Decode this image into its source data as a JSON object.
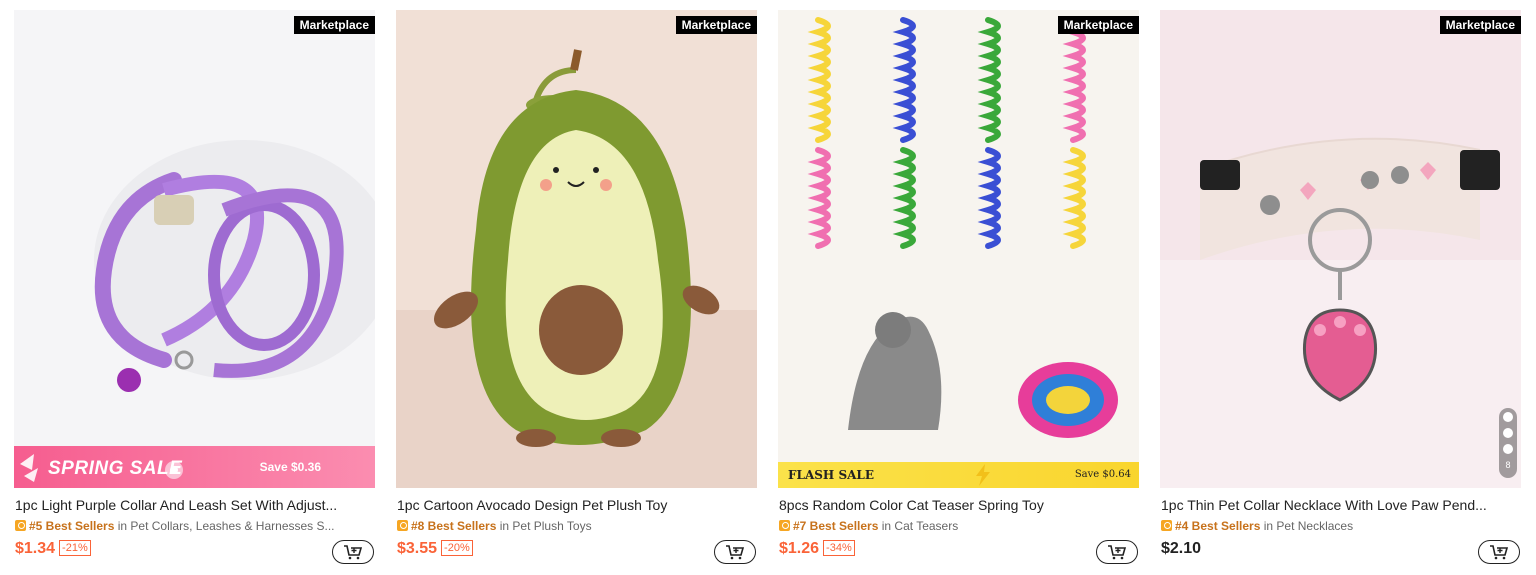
{
  "products": [
    {
      "badge": "Marketplace",
      "promo": "SPRING SALE",
      "promo_save": "Save $0.36",
      "title": "1pc Light Purple Collar And Leash Set With Adjust...",
      "rank": "#5 Best Sellers",
      "category": "in Pet Collars, Leashes & Harnesses S...",
      "price": "$1.34",
      "discount": "-21%"
    },
    {
      "badge": "Marketplace",
      "title": "1pc Cartoon Avocado Design Pet Plush Toy",
      "rank": "#8 Best Sellers",
      "category": "in Pet Plush Toys",
      "price": "$3.55",
      "discount": "-20%"
    },
    {
      "badge": "Marketplace",
      "promo": "FLASH SALE",
      "promo_save": "Save $0.64",
      "title": "8pcs Random Color Cat Teaser Spring Toy",
      "rank": "#7 Best Sellers",
      "category": "in Cat Teasers",
      "price": "$1.26",
      "discount": "-34%"
    },
    {
      "badge": "Marketplace",
      "title": "1pc Thin Pet Collar Necklace With Love Paw Pend...",
      "rank": "#4 Best Sellers",
      "category": "in Pet Necklaces",
      "price": "$2.10",
      "image_counter": "8"
    }
  ],
  "icons": {
    "cart": "add-to-cart-icon",
    "medal": "best-seller-medal-icon"
  },
  "colors": {
    "price": "#fa6338",
    "rank": "#c7721c",
    "spring": "#f65d8f",
    "flash": "#fbe24a"
  }
}
